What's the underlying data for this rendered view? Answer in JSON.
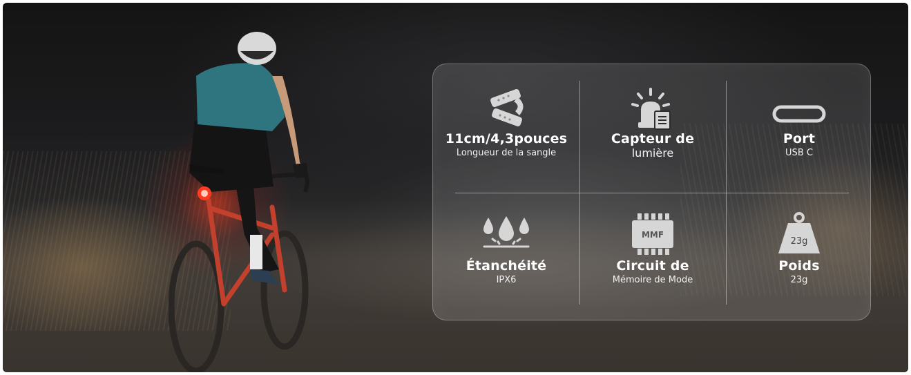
{
  "specs": [
    {
      "icon": "strap-icon",
      "title": "11cm/4,3pouces",
      "subtitle": "Longueur de la sangle"
    },
    {
      "icon": "light-sensor-icon",
      "title": "Capteur de",
      "subtitle": "lumière"
    },
    {
      "icon": "usb-c-port-icon",
      "title": "Port",
      "subtitle": "USB C"
    },
    {
      "icon": "water-drops-icon",
      "title": "Étanchéité",
      "subtitle": "IPX6"
    },
    {
      "icon": "memory-chip-icon",
      "title": "Circuit de",
      "subtitle": "Mémoire de Mode",
      "icon_text": "MMF"
    },
    {
      "icon": "weight-icon",
      "title": "Poids",
      "subtitle": "23g",
      "icon_text": "23g"
    }
  ],
  "colors": {
    "icon": "#d6d6d6",
    "text": "#ffffff",
    "tail_light": "#ff3b1f"
  }
}
